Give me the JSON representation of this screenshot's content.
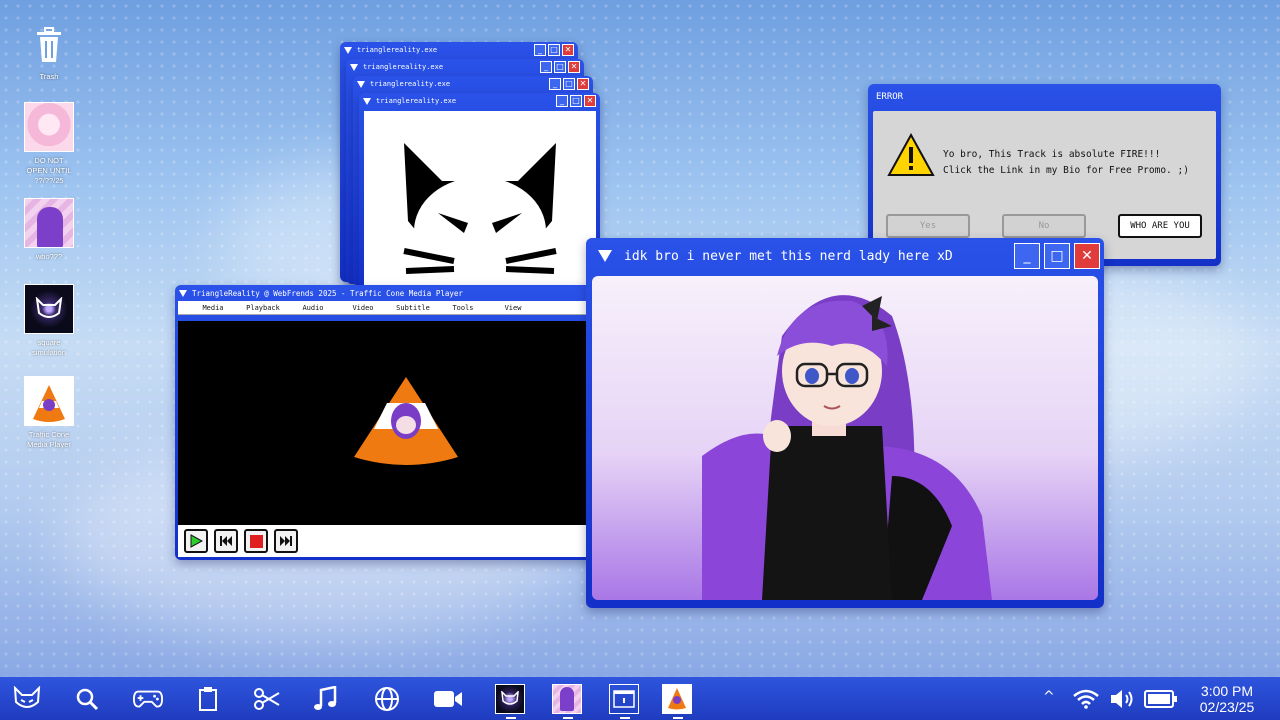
{
  "desktop": {
    "icons": [
      {
        "label": "Trash"
      },
      {
        "label": "DO NOT\nOPEN UNTIL\n??/??/25"
      },
      {
        "label": "who???"
      },
      {
        "label": "square\nsimulation"
      },
      {
        "label": "Traffic Cone\nMedia Player"
      }
    ]
  },
  "stacked_windows": [
    {
      "title": "trianglereality.exe"
    },
    {
      "title": "trianglereality.exe"
    },
    {
      "title": "trianglereality.exe"
    },
    {
      "title": "trianglereality.exe"
    }
  ],
  "media_player": {
    "title": "TriangleReality @ WebFrends 2025 - Traffic Cone Media Player",
    "menu": [
      "Media",
      "Playback",
      "Audio",
      "Video",
      "Subtitle",
      "Tools",
      "View"
    ]
  },
  "error_dialog": {
    "title": "ERROR",
    "line1": "Yo bro, This Track is absolute FIRE!!!",
    "line2": "Click the Link in my Bio for Free Promo. ;)",
    "buttons": {
      "yes": "Yes",
      "no": "No",
      "who": "WHO ARE YOU"
    }
  },
  "main_window": {
    "title": "idk bro i never met this nerd lady here xD"
  },
  "taskbar": {
    "time": "3:00 PM",
    "date": "02/23/25",
    "icons": [
      "cat-icon",
      "search-icon",
      "gamepad-icon",
      "clipboard-icon",
      "scissors-icon",
      "music-icon",
      "globe-icon",
      "video-icon"
    ]
  },
  "colors": {
    "window_blue": "#1e3fd6",
    "close_red": "#e03c3c",
    "cone_orange": "#f07a12",
    "purple": "#8b45d8"
  }
}
